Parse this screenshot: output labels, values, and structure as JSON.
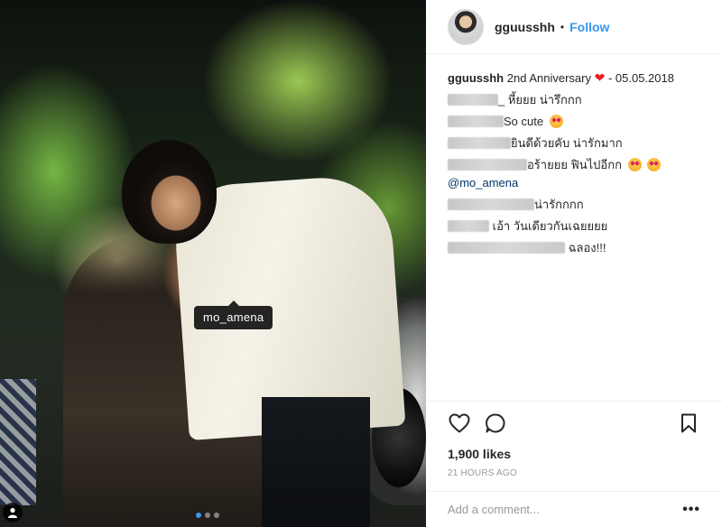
{
  "colors": {
    "accent": "#3897f0",
    "heart": "#ed1c24",
    "muted": "#999999",
    "text": "#262626"
  },
  "photo": {
    "tag_label": "mo_amena",
    "carousel": {
      "count": 3,
      "active_index": 0
    }
  },
  "header": {
    "username": "gguusshh",
    "separator": "•",
    "follow_label": "Follow"
  },
  "caption": {
    "username": "gguusshh",
    "text_before": "2nd Anniversary",
    "text_after": "- 05.05.2018"
  },
  "comments": [
    {
      "text": "_ หี้ยยย น่ารึกกก"
    },
    {
      "text": "So cute"
    },
    {
      "text": "ยินดีด้วยคับ น่ารักมาก"
    },
    {
      "text": "อร้ายยย ฟินไปอีกก"
    },
    {
      "text": "@mo_amena"
    },
    {
      "text": "น่ารักกกก"
    },
    {
      "text": "เอ้า วันเดียวกันเฉยยยย"
    },
    {
      "text": "ฉลอง!!!"
    }
  ],
  "icons": {
    "like": "heart-outline-icon",
    "comment": "speech-bubble-icon",
    "save": "bookmark-icon",
    "user_tag": "person-icon"
  },
  "likes_text": "1,900 likes",
  "timestamp": "21 HOURS AGO",
  "add_comment": {
    "placeholder": "Add a comment...",
    "more_label": "•••"
  }
}
